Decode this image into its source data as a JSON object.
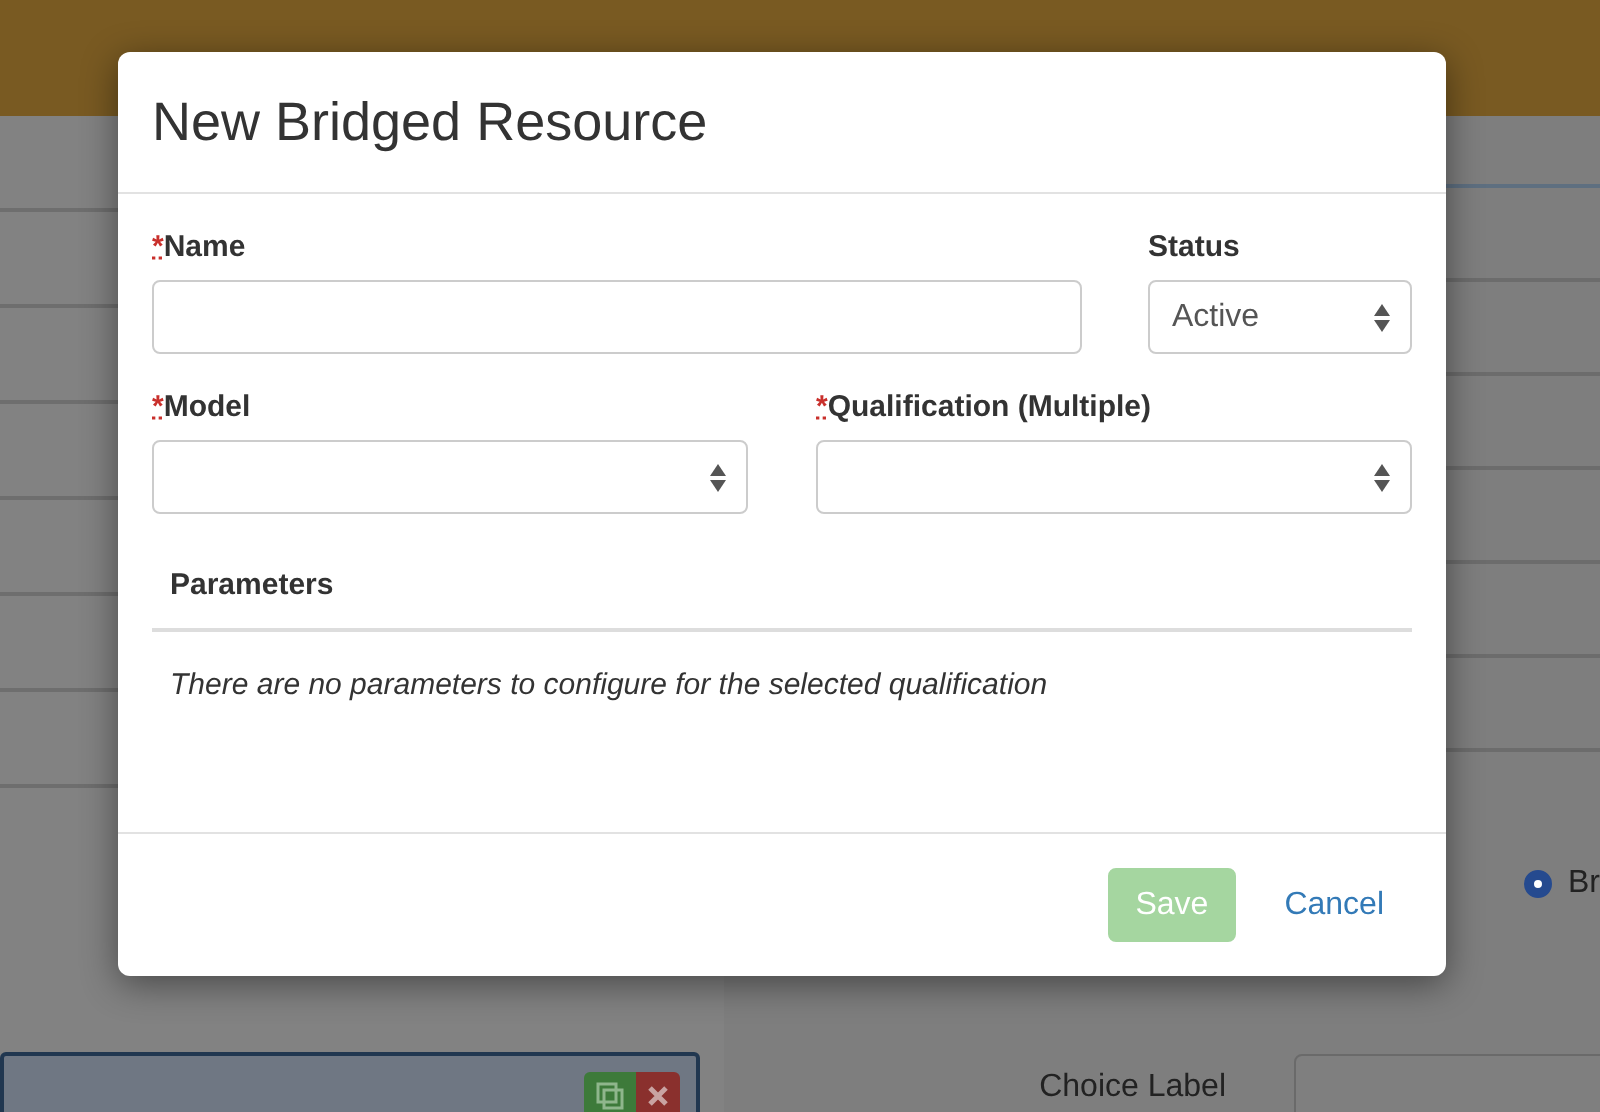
{
  "background": {
    "radio": {
      "label": "Br",
      "selected": true
    },
    "fields": [
      {
        "label": "Choice Label"
      }
    ]
  },
  "modal": {
    "title": "New Bridged Resource",
    "required_mark": "*",
    "fields": [
      {
        "label": "Name",
        "required": true,
        "kind": "text"
      },
      {
        "label": "Status",
        "required": false,
        "kind": "select",
        "value": "Active"
      },
      {
        "label": "Model",
        "required": true,
        "kind": "select"
      },
      {
        "label": "Qualification (Multiple)",
        "required": true,
        "kind": "select"
      }
    ],
    "parameters": {
      "heading": "Parameters",
      "message": "There are no parameters to configure for the selected qualification"
    },
    "buttons": [
      {
        "label": "Save",
        "kind": "primary",
        "disabled": true
      },
      {
        "label": "Cancel",
        "kind": "link",
        "disabled": false
      }
    ]
  }
}
